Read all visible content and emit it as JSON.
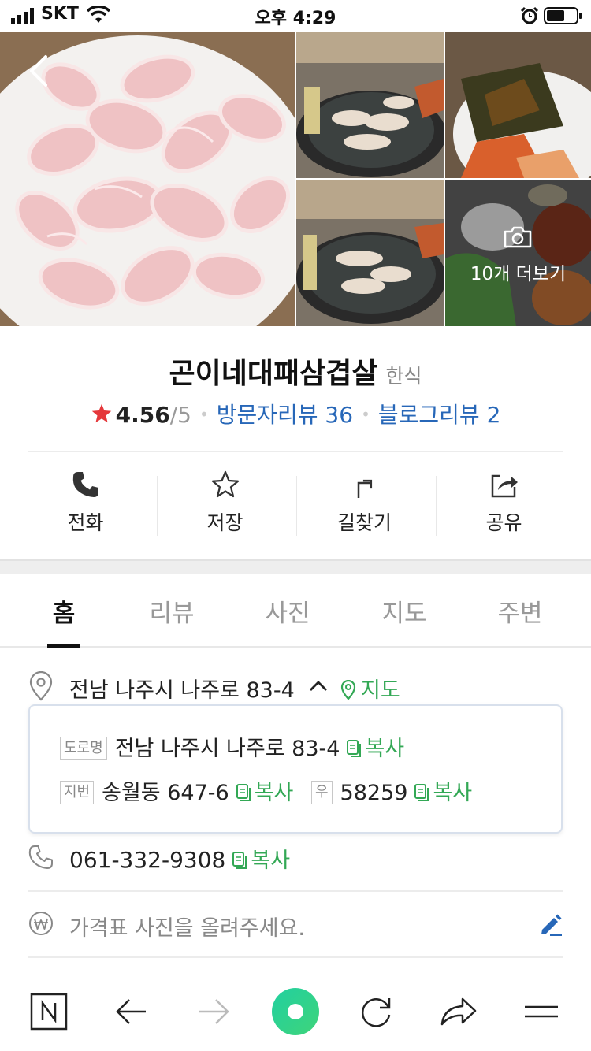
{
  "status_bar": {
    "carrier": "SKT",
    "time": "오후 4:29"
  },
  "gallery": {
    "more_label": "10개 더보기"
  },
  "place": {
    "name": "곤이네대패삼겹살",
    "category": "한식",
    "rating": "4.56",
    "rating_max": "/5",
    "visitor_reviews": "방문자리뷰 36",
    "blog_reviews": "블로그리뷰 2"
  },
  "actions": [
    {
      "label": "전화",
      "icon": "phone-icon"
    },
    {
      "label": "저장",
      "icon": "star-outline-icon"
    },
    {
      "label": "길찾기",
      "icon": "directions-icon"
    },
    {
      "label": "공유",
      "icon": "share-icon"
    }
  ],
  "tabs": [
    "홈",
    "리뷰",
    "사진",
    "지도",
    "주변"
  ],
  "address": {
    "summary": "전남 나주시 나주로 83-4",
    "map_link": "지도",
    "road_tag": "도로명",
    "road_address": "전남 나주시 나주로 83-4",
    "lot_tag": "지번",
    "lot_address": "송월동 647-6",
    "postal_tag": "우",
    "postal_code": "58259",
    "copy_label": "복사"
  },
  "phone": {
    "number": "061-332-9308",
    "copy_label": "복사"
  },
  "price": {
    "placeholder": "가격표 사진을 올려주세요."
  },
  "colors": {
    "accent_green": "#33a855",
    "link_blue": "#2767b8",
    "star_red": "#e5383b",
    "naver_green": "#2ecf83"
  }
}
